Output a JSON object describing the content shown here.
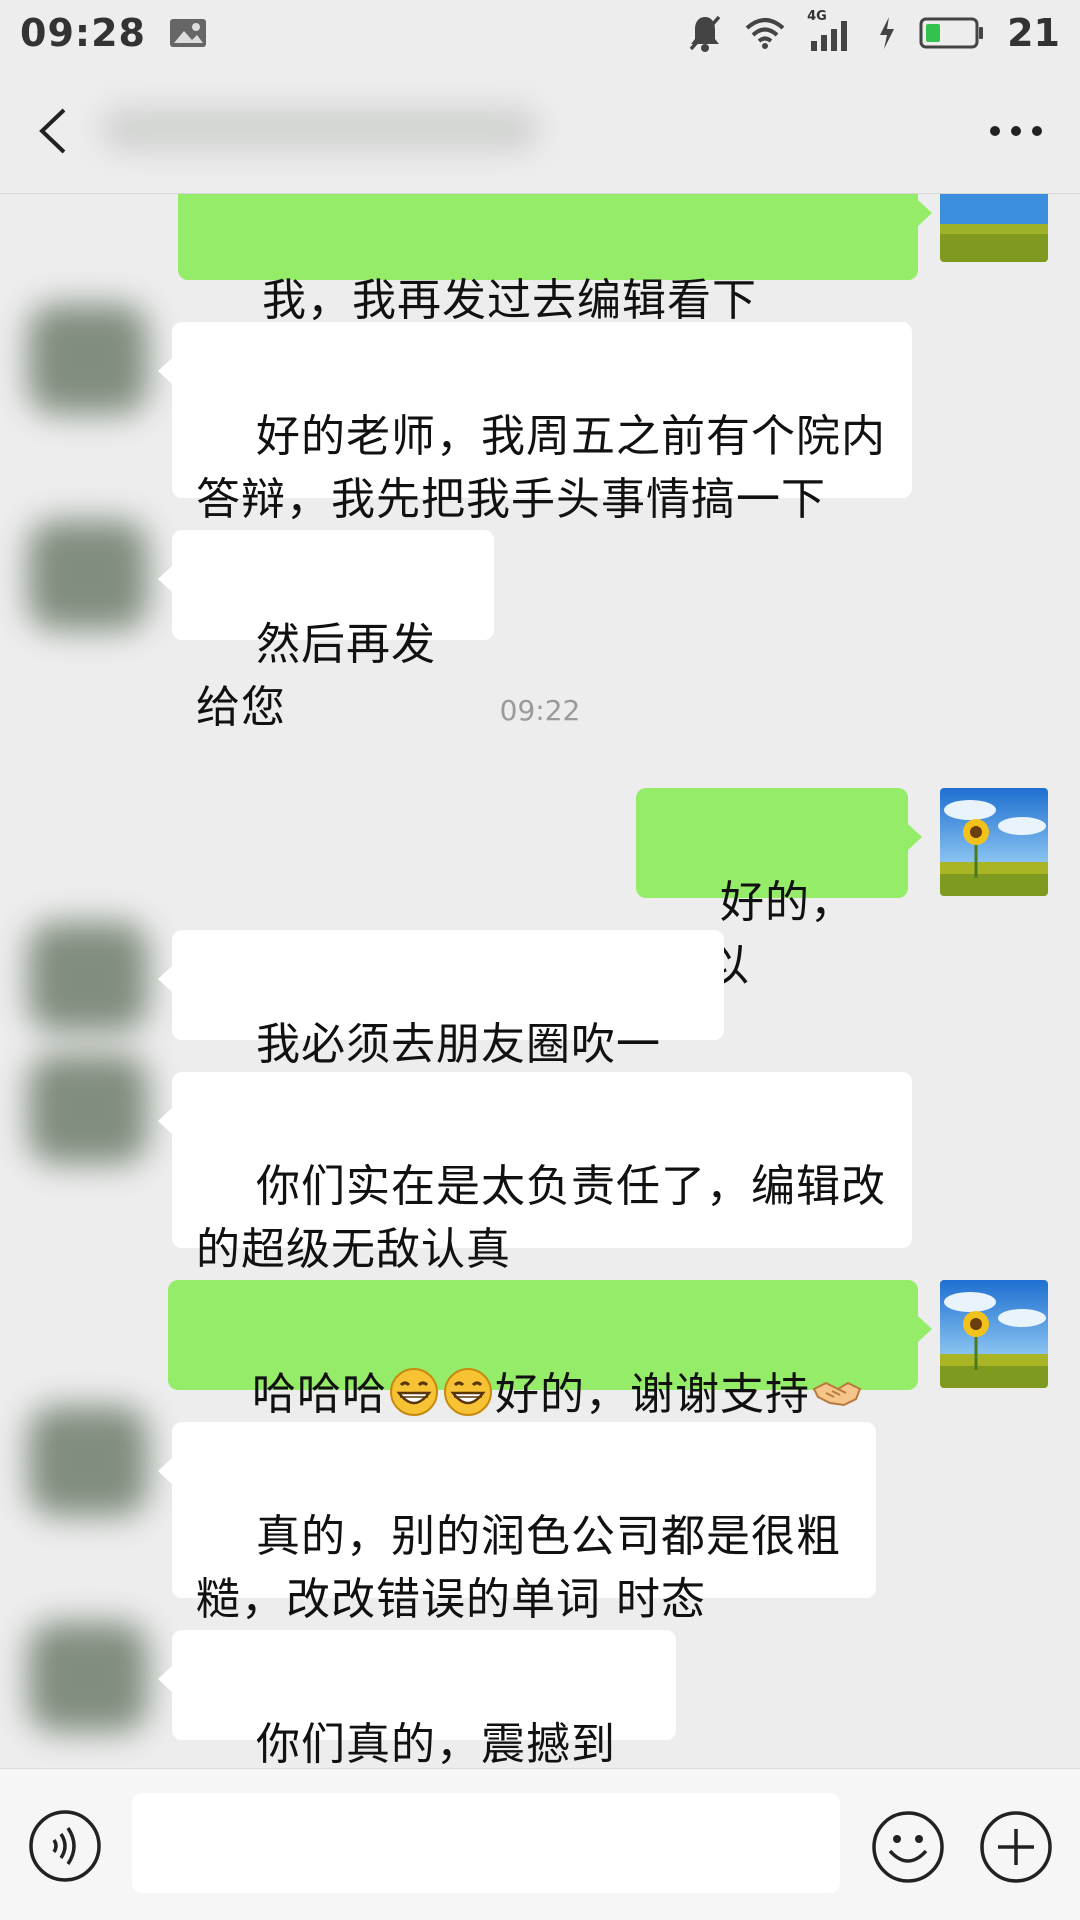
{
  "status_bar": {
    "time": "09:28",
    "network": "4G",
    "battery_level": "21"
  },
  "header": {
    "back_icon": "chevron-left-icon",
    "more_icon": "ellipsis-icon"
  },
  "messages": [
    {
      "side": "out",
      "text": "我，我再发过去编辑看下"
    },
    {
      "side": "in",
      "text": "好的老师，我周五之前有个院内答辩，我先把我手头事情搞一下"
    },
    {
      "side": "in",
      "text": "然后再发给您"
    },
    {
      "side": "time",
      "text": "09:22"
    },
    {
      "side": "out",
      "text": "好的，可以"
    },
    {
      "side": "in",
      "text": "我必须去朋友圈吹一波了"
    },
    {
      "side": "in",
      "text": "你们实在是太负责任了，编辑改的超级无敌认真"
    },
    {
      "side": "out",
      "text_before": "哈哈哈",
      "text_after": "好的，谢谢支持",
      "emojis": [
        "grin-emoji",
        "grin-emoji",
        "handshake-emoji",
        "handshake-emoji"
      ]
    },
    {
      "side": "in",
      "text": "真的，别的润色公司都是很粗糙，改改错误的单词 时态"
    },
    {
      "side": "in",
      "text": "你们真的，震撼到我了"
    }
  ],
  "colors": {
    "outgoing_bubble": "#95ec69",
    "incoming_bubble": "#ffffff",
    "background": "#ededed"
  },
  "input_bar": {
    "voice_icon": "voice-icon",
    "emoji_icon": "smiley-icon",
    "plus_icon": "plus-icon",
    "text_value": ""
  }
}
